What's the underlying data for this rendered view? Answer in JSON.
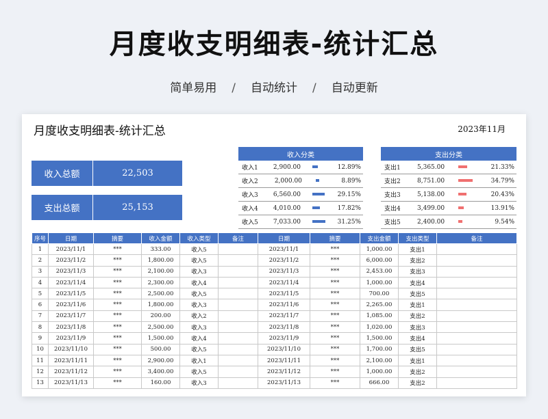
{
  "header": {
    "title": "月度收支明细表-统计汇总",
    "subtitle_items": [
      "简单易用",
      "自动统计",
      "自动更新"
    ],
    "separator": "/"
  },
  "sheet": {
    "title": "月度收支明细表-统计汇总",
    "month": "2023年11月",
    "income_total_label": "收入总额",
    "income_total_value": "22,503",
    "expense_total_label": "支出总额",
    "expense_total_value": "25,153"
  },
  "colors": {
    "accent": "#4472c4",
    "expense_bar": "#f07070",
    "income_bar": "#4472c4"
  },
  "income_categories": {
    "title": "收入分类",
    "rows": [
      {
        "name": "收入1",
        "amount": "2,900.00",
        "pct": "12.89%",
        "frac": 0.1289
      },
      {
        "name": "收入2",
        "amount": "2,000.00",
        "pct": "8.89%",
        "frac": 0.0889
      },
      {
        "name": "收入3",
        "amount": "6,560.00",
        "pct": "29.15%",
        "frac": 0.2915
      },
      {
        "name": "收入4",
        "amount": "4,010.00",
        "pct": "17.82%",
        "frac": 0.1782
      },
      {
        "name": "收入5",
        "amount": "7,033.00",
        "pct": "31.25%",
        "frac": 0.3125
      }
    ]
  },
  "expense_categories": {
    "title": "支出分类",
    "rows": [
      {
        "name": "支出1",
        "amount": "5,365.00",
        "pct": "21.33%",
        "frac": 0.2133
      },
      {
        "name": "支出2",
        "amount": "8,751.00",
        "pct": "34.79%",
        "frac": 0.3479
      },
      {
        "name": "支出3",
        "amount": "5,138.00",
        "pct": "20.43%",
        "frac": 0.2043
      },
      {
        "name": "支出4",
        "amount": "3,499.00",
        "pct": "13.91%",
        "frac": 0.1391
      },
      {
        "name": "支出5",
        "amount": "2,400.00",
        "pct": "9.54%",
        "frac": 0.0954
      }
    ]
  },
  "table": {
    "headers": [
      "序号",
      "日期",
      "摘要",
      "收入金额",
      "收入类型",
      "备注",
      "日期",
      "摘要",
      "支出金额",
      "支出类型",
      "备注"
    ],
    "rows": [
      [
        "1",
        "2023/11/1",
        "***",
        "333.00",
        "收入5",
        "",
        "2023/11/1",
        "***",
        "1,000.00",
        "支出1",
        ""
      ],
      [
        "2",
        "2023/11/2",
        "***",
        "1,800.00",
        "收入5",
        "",
        "2023/11/2",
        "***",
        "6,000.00",
        "支出2",
        ""
      ],
      [
        "3",
        "2023/11/3",
        "***",
        "2,100.00",
        "收入3",
        "",
        "2023/11/3",
        "***",
        "2,453.00",
        "支出3",
        ""
      ],
      [
        "4",
        "2023/11/4",
        "***",
        "2,300.00",
        "收入4",
        "",
        "2023/11/4",
        "***",
        "1,000.00",
        "支出4",
        ""
      ],
      [
        "5",
        "2023/11/5",
        "***",
        "2,500.00",
        "收入5",
        "",
        "2023/11/5",
        "***",
        "700.00",
        "支出5",
        ""
      ],
      [
        "6",
        "2023/11/6",
        "***",
        "1,800.00",
        "收入3",
        "",
        "2023/11/6",
        "***",
        "2,265.00",
        "支出1",
        ""
      ],
      [
        "7",
        "2023/11/7",
        "***",
        "200.00",
        "收入2",
        "",
        "2023/11/7",
        "***",
        "1,085.00",
        "支出2",
        ""
      ],
      [
        "8",
        "2023/11/8",
        "***",
        "2,500.00",
        "收入3",
        "",
        "2023/11/8",
        "***",
        "1,020.00",
        "支出3",
        ""
      ],
      [
        "9",
        "2023/11/9",
        "***",
        "1,500.00",
        "收入4",
        "",
        "2023/11/9",
        "***",
        "1,500.00",
        "支出4",
        ""
      ],
      [
        "10",
        "2023/11/10",
        "***",
        "500.00",
        "收入5",
        "",
        "2023/11/10",
        "***",
        "1,700.00",
        "支出5",
        ""
      ],
      [
        "11",
        "2023/11/11",
        "***",
        "2,900.00",
        "收入1",
        "",
        "2023/11/11",
        "***",
        "2,100.00",
        "支出1",
        ""
      ],
      [
        "12",
        "2023/11/12",
        "***",
        "3,400.00",
        "收入5",
        "",
        "2023/11/12",
        "***",
        "1,000.00",
        "支出2",
        ""
      ],
      [
        "13",
        "2023/11/13",
        "***",
        "160.00",
        "收入3",
        "",
        "2023/11/13",
        "***",
        "666.00",
        "支出2",
        ""
      ]
    ]
  }
}
